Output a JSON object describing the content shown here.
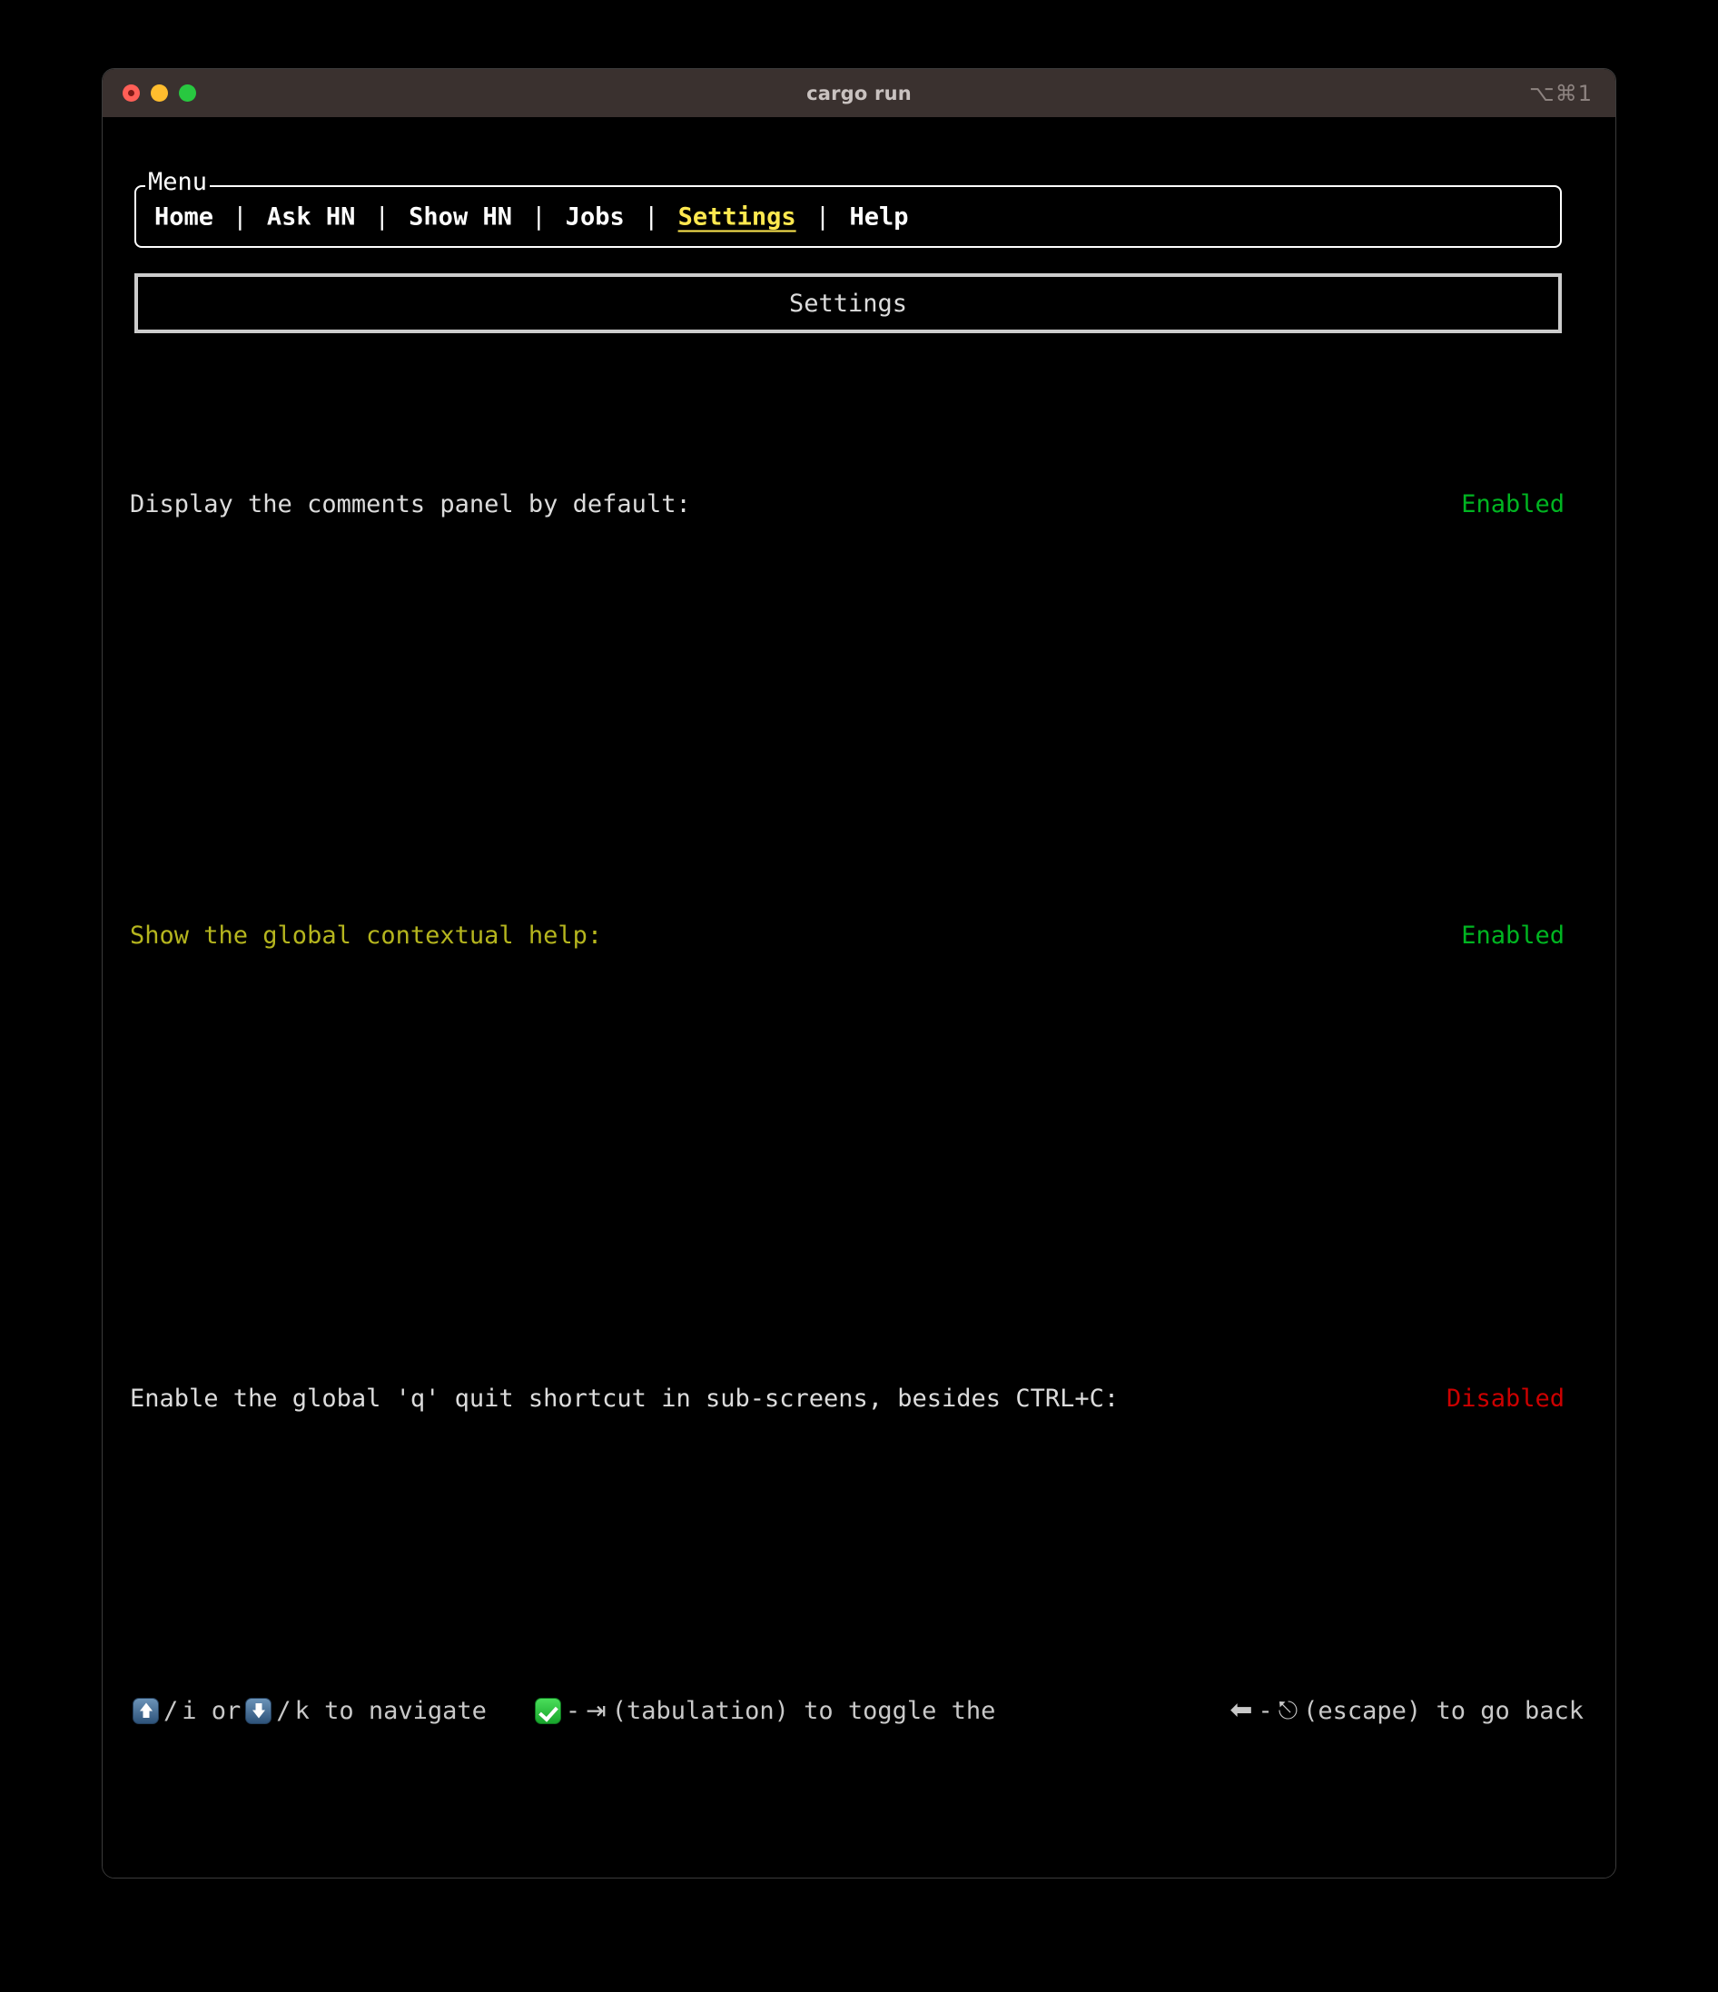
{
  "window": {
    "title": "cargo run",
    "shortcut": "⌥⌘1",
    "traffic_lights": [
      "close",
      "minimize",
      "zoom"
    ]
  },
  "menu": {
    "legend": "Menu",
    "separator": "|",
    "items": [
      {
        "label": "Home",
        "active": false
      },
      {
        "label": "Ask HN",
        "active": false
      },
      {
        "label": "Show HN",
        "active": false
      },
      {
        "label": "Jobs",
        "active": false
      },
      {
        "label": "Settings",
        "active": true
      },
      {
        "label": "Help",
        "active": false
      }
    ]
  },
  "screen": {
    "header": "Settings"
  },
  "settings": [
    {
      "label": "Display the comments panel by default:",
      "value": "Enabled",
      "state": "on",
      "selected": false
    },
    {
      "label": "Show the global contextual help:",
      "value": "Enabled",
      "state": "on",
      "selected": true
    },
    {
      "label": "Enable the global 'q' quit shortcut in sub-screens, besides CTRL+C:",
      "value": "Disabled",
      "state": "off",
      "selected": false
    }
  ],
  "helpbar": {
    "nav": {
      "up_icon": "arrow-up-emoji",
      "sep1": "/",
      "key1": "i or",
      "down_icon": "arrow-down-emoji",
      "sep2": "/",
      "key2": "k to navigate"
    },
    "toggle": {
      "check_icon": "check-mark-emoji",
      "dash": "-",
      "tab_glyph": "⇥",
      "text": "(tabulation) to toggle the"
    },
    "back": {
      "left_arrow": "⬅",
      "dash": "-",
      "esc_glyph": "⎋",
      "text": "(escape) to go back"
    }
  },
  "colors": {
    "accent_yellow": "#ffe84f",
    "selected_label": "#b5b51e",
    "enabled_green": "#00b521",
    "disabled_red": "#cc0000",
    "titlebar": "#3a312f",
    "border_white": "#ffffff",
    "border_gray": "#cccccc",
    "background": "#000000"
  }
}
